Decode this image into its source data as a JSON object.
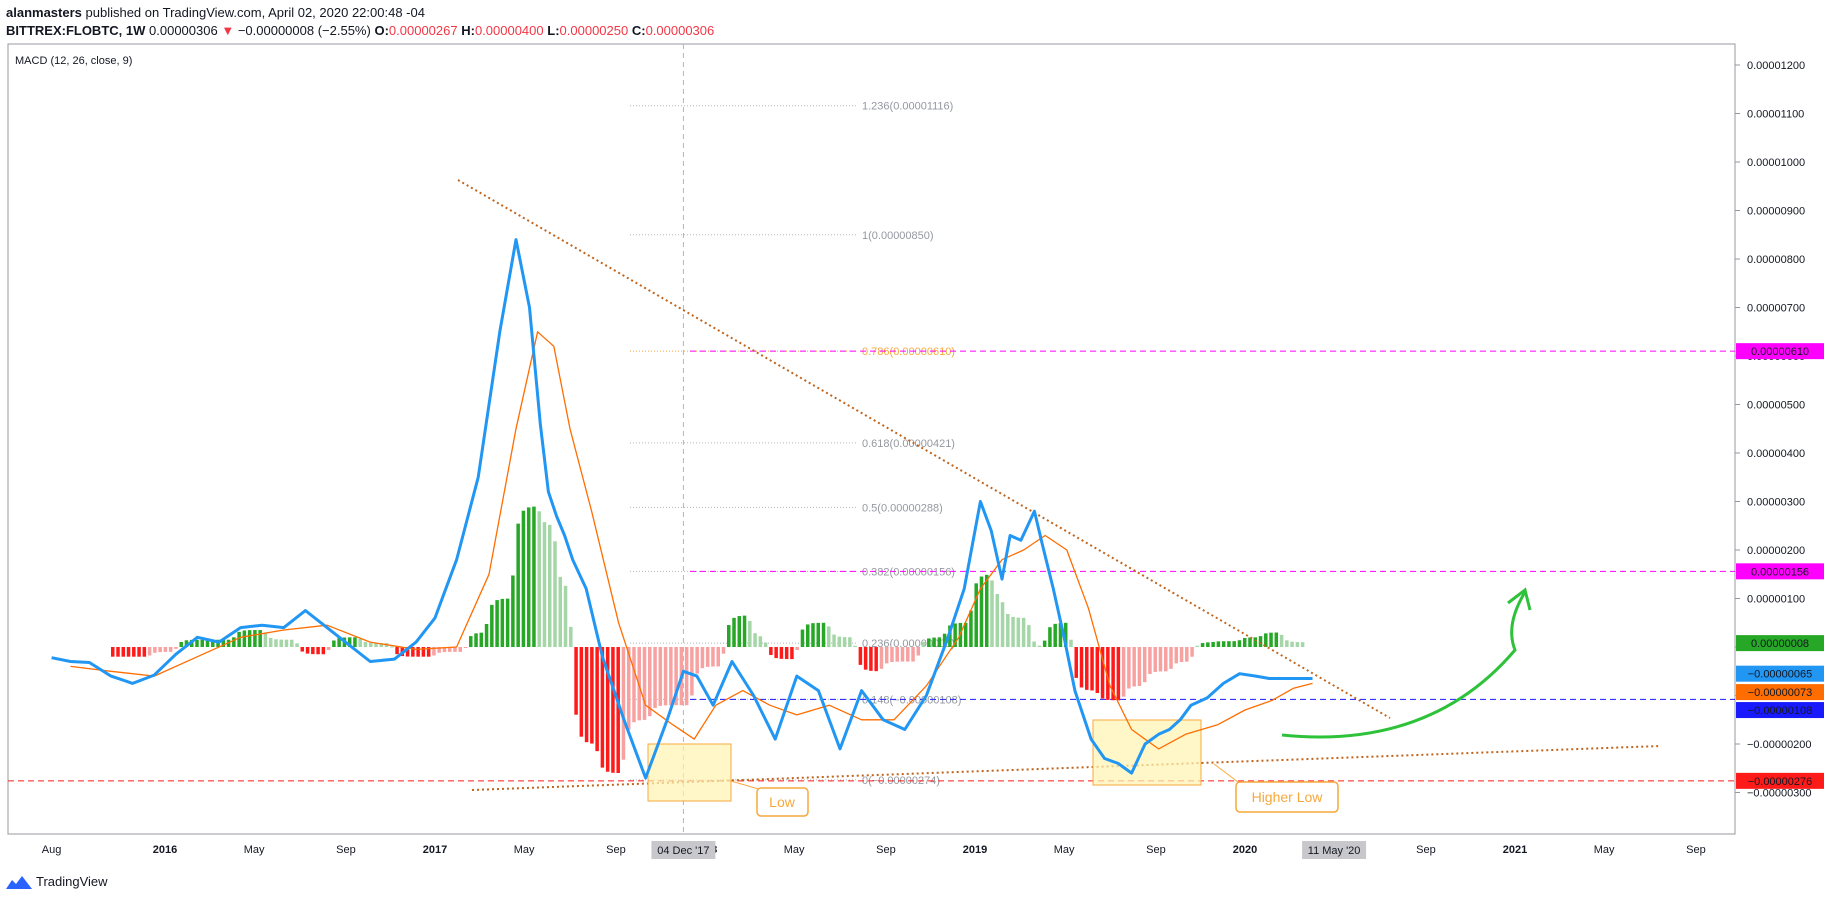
{
  "header": {
    "line1_user": "alanmasters",
    "line1_rest": " published on TradingView.com, April 02, 2020 22:00:48 -04",
    "symbol": "BITTREX:FLOBTC, 1W",
    "last": "0.00000306",
    "arrow": "▼",
    "change": "−0.00000008 (−2.55%)",
    "o_label": "O:",
    "o_val": "0.00000267",
    "h_label": "H:",
    "h_val": "0.00000400",
    "l_label": "L:",
    "l_val": "0.00000250",
    "c_label": "C:",
    "c_val": "0.00000306"
  },
  "indicator_title": "MACD (12, 26, close, 9)",
  "footer": {
    "brand": "TradingView"
  },
  "colors": {
    "macd": "#2196f3",
    "signal": "#ff6d00",
    "hist_pos_strong": "#26a726",
    "hist_pos_weak": "#a5d6a7",
    "hist_neg_strong": "#ff1a1a",
    "hist_neg_weak": "#f7a1a1",
    "magenta": "#ff00ff",
    "trend": "#c0641c",
    "green_arrow": "#2ec23a",
    "box_fill": "#fff3b0",
    "box_stroke": "#f7a83c"
  },
  "chart_data": {
    "type": "line",
    "title": "MACD (12, 26, close, 9)",
    "y_ticks": [
      "0.00001200",
      "0.00001100",
      "0.00001000",
      "0.00000900",
      "0.00000800",
      "0.00000700",
      "0.00000600",
      "0.00000500",
      "0.00000400",
      "0.00000300",
      "0.00000200",
      "0.00000100",
      "0.00000000",
      "−0.00000100",
      "−0.00000200",
      "−0.00000300"
    ],
    "y_range": [
      -3.75e-06,
      1.26e-05
    ],
    "x_ticks": [
      "Aug",
      "2016",
      "May",
      "Sep",
      "2017",
      "May",
      "Sep",
      "2018",
      "May",
      "Sep",
      "2019",
      "May",
      "Sep",
      "2020",
      "May",
      "Sep",
      "2021",
      "May",
      "Sep"
    ],
    "x_range": [
      "2015-06",
      "2021-11"
    ],
    "markers": {
      "crosshair_date": "04 Dec '17",
      "end_date": "11 May '20"
    },
    "price_labels": [
      {
        "value": "0.00000610",
        "color": "#ff00ff"
      },
      {
        "value": "0.00000156",
        "color": "#ff00ff"
      },
      {
        "value": "0.00000008",
        "color": "#26a726"
      },
      {
        "value": "−0.00000065",
        "color": "#2196f3"
      },
      {
        "value": "−0.00000073",
        "color": "#ff6d00"
      },
      {
        "value": "−0.00000108",
        "color": "#1a1aff"
      },
      {
        "value": "−0.00000276",
        "color": "#ff1a1a"
      }
    ],
    "fib_levels": [
      {
        "label": "1.236(0.00001116)",
        "value": 1.116e-05
      },
      {
        "label": "1(0.00000850)",
        "value": 8.5e-06
      },
      {
        "label": "0.786(0.00000610)",
        "value": 6.1e-06
      },
      {
        "label": "0.618(0.00000421)",
        "value": 4.21e-06
      },
      {
        "label": "0.5(0.00000288)",
        "value": 2.88e-06
      },
      {
        "label": "0.382(0.00000156)",
        "value": 1.56e-06
      },
      {
        "label": "0.236(0.00000008)",
        "value": 8e-08
      },
      {
        "label": "0.148(−0.00000108)",
        "value": -1.08e-06
      },
      {
        "label": "0(−0.00000274)",
        "value": -2.74e-06
      }
    ],
    "annotations": [
      "Low",
      "Higher Low"
    ],
    "series": [
      {
        "name": "MACD",
        "x": [
          2015.58,
          2015.65,
          2015.72,
          2015.8,
          2015.88,
          2015.96,
          2016.04,
          2016.12,
          2016.2,
          2016.28,
          2016.36,
          2016.44,
          2016.52,
          2016.6,
          2016.68,
          2016.76,
          2016.85,
          2016.93,
          2017.0,
          2017.08,
          2017.16,
          2017.24,
          2017.3,
          2017.35,
          2017.39,
          2017.42,
          2017.45,
          2017.48,
          2017.51,
          2017.56,
          2017.62,
          2017.7,
          2017.78,
          2017.86,
          2017.92,
          2017.97,
          2018.03,
          2018.1,
          2018.18,
          2018.26,
          2018.34,
          2018.42,
          2018.5,
          2018.58,
          2018.66,
          2018.74,
          2018.82,
          2018.9,
          2018.96,
          2019.02,
          2019.06,
          2019.1,
          2019.13,
          2019.17,
          2019.22,
          2019.25,
          2019.29,
          2019.33,
          2019.37,
          2019.43,
          2019.48,
          2019.53,
          2019.58,
          2019.63,
          2019.68,
          2019.72,
          2019.76,
          2019.8,
          2019.86,
          2019.92,
          2019.98,
          2020.04,
          2020.09,
          2020.14,
          2020.2,
          2020.25
        ],
        "values": [
          -0.22,
          -0.3,
          -0.32,
          -0.6,
          -0.75,
          -0.58,
          -0.15,
          0.2,
          0.1,
          0.4,
          0.45,
          0.4,
          0.75,
          0.4,
          0.05,
          -0.3,
          -0.25,
          0.1,
          0.6,
          1.8,
          3.5,
          6.5,
          8.4,
          7.0,
          4.6,
          3.2,
          2.7,
          2.3,
          1.8,
          1.2,
          -0.2,
          -1.5,
          -2.7,
          -1.5,
          -0.5,
          -0.6,
          -1.2,
          -0.3,
          -1.0,
          -1.9,
          -0.6,
          -0.9,
          -2.1,
          -0.9,
          -1.5,
          -1.7,
          -1.0,
          0.2,
          1.2,
          3.0,
          2.4,
          1.4,
          2.3,
          2.2,
          2.8,
          2.1,
          1.2,
          0.2,
          -0.9,
          -1.9,
          -2.3,
          -2.4,
          -2.6,
          -2.0,
          -1.8,
          -1.7,
          -1.5,
          -1.2,
          -1.05,
          -0.75,
          -0.55,
          -0.6,
          -0.65,
          -0.65,
          -0.65,
          -0.65
        ]
      },
      {
        "name": "Signal",
        "x": [
          2015.65,
          2015.8,
          2015.96,
          2016.12,
          2016.28,
          2016.44,
          2016.6,
          2016.76,
          2016.93,
          2017.08,
          2017.2,
          2017.3,
          2017.38,
          2017.44,
          2017.5,
          2017.58,
          2017.68,
          2017.78,
          2017.88,
          2017.96,
          2018.04,
          2018.14,
          2018.24,
          2018.34,
          2018.46,
          2018.58,
          2018.7,
          2018.82,
          2018.94,
          2019.02,
          2019.1,
          2019.18,
          2019.26,
          2019.34,
          2019.42,
          2019.5,
          2019.58,
          2019.68,
          2019.78,
          2019.9,
          2020.0,
          2020.1,
          2020.18,
          2020.25
        ],
        "values": [
          -0.4,
          -0.5,
          -0.6,
          -0.2,
          0.2,
          0.35,
          0.45,
          0.1,
          -0.05,
          0.0,
          1.5,
          4.5,
          6.5,
          6.2,
          4.5,
          2.8,
          0.5,
          -1.2,
          -1.6,
          -1.9,
          -1.2,
          -0.9,
          -1.2,
          -1.4,
          -1.2,
          -1.5,
          -1.5,
          -0.8,
          0.2,
          1.2,
          1.8,
          2.0,
          2.3,
          2.0,
          0.8,
          -0.8,
          -1.7,
          -2.1,
          -1.8,
          -1.6,
          -1.3,
          -1.1,
          -0.85,
          -0.75
        ]
      }
    ]
  }
}
